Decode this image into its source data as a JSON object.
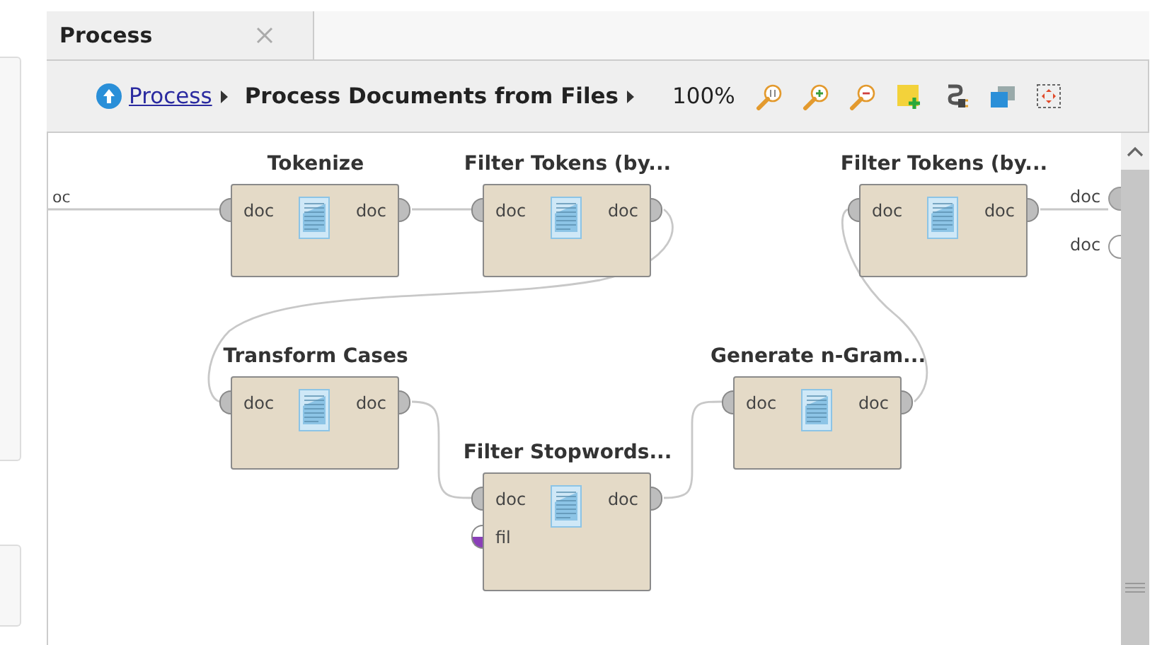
{
  "tab": {
    "label": "Process",
    "selected": true
  },
  "breadcrumb": [
    {
      "label": "Process",
      "kind": "link"
    },
    {
      "label": "Process Documents from Files",
      "kind": "current"
    }
  ],
  "zoom": "100%",
  "canvas": {
    "input_port_label": "oc",
    "nodes": [
      {
        "title": "Tokenize",
        "inputs": [
          {
            "label": "doc",
            "kind": "document"
          }
        ],
        "outputs": [
          "doc"
        ]
      },
      {
        "title": "Filter Tokens (by...",
        "inputs": [
          {
            "label": "doc",
            "kind": "document"
          }
        ],
        "outputs": [
          "doc"
        ]
      },
      {
        "title": "Filter Tokens (by...",
        "inputs": [
          {
            "label": "doc",
            "kind": "document"
          }
        ],
        "outputs": [
          "doc"
        ]
      },
      {
        "title": "Transform Cases",
        "inputs": [
          {
            "label": "doc",
            "kind": "document"
          }
        ],
        "outputs": [
          "doc"
        ]
      },
      {
        "title": "Generate n-Gram...",
        "inputs": [
          {
            "label": "doc",
            "kind": "document"
          }
        ],
        "outputs": [
          "doc"
        ]
      },
      {
        "title": "Filter Stopwords...",
        "inputs": [
          {
            "label": "doc",
            "kind": "document"
          },
          {
            "label": "fil",
            "kind": "file"
          }
        ],
        "outputs": [
          "doc"
        ]
      }
    ],
    "output_ports": [
      {
        "label": "doc",
        "connected": true
      },
      {
        "label": "doc",
        "connected": false
      }
    ]
  }
}
